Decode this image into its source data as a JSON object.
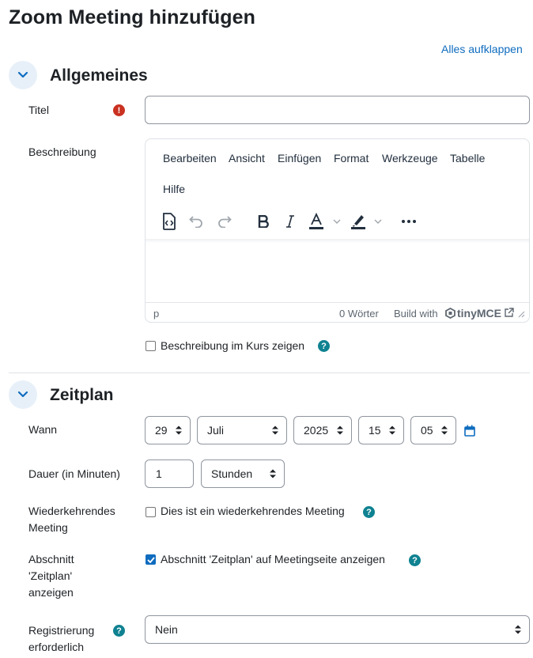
{
  "page": {
    "title": "Zoom Meeting hinzufügen",
    "expand_all": "Alles aufklappen"
  },
  "sections": {
    "general": {
      "title": "Allgemeines"
    },
    "schedule": {
      "title": "Zeitplan"
    }
  },
  "fields": {
    "title": {
      "label": "Titel",
      "value": ""
    },
    "description": {
      "label": "Beschreibung",
      "menu": [
        "Bearbeiten",
        "Ansicht",
        "Einfügen",
        "Format",
        "Werkzeuge",
        "Tabelle",
        "Hilfe"
      ],
      "statusbar": {
        "path": "p",
        "word_count": "0 Wörter",
        "build_with": "Build with",
        "brand": "tinyMCE"
      },
      "show_in_course_label": "Beschreibung im Kurs zeigen",
      "show_in_course_checked": false
    },
    "when": {
      "label": "Wann",
      "day": "29",
      "month": "Juli",
      "year": "2025",
      "hour": "15",
      "minute": "05"
    },
    "duration": {
      "label": "Dauer (in Minuten)",
      "value": "1",
      "unit": "Stunden"
    },
    "recurring": {
      "label": "Wiederkehrendes Meeting",
      "checkbox_label": "Dies ist ein wiederkehrendes Meeting",
      "checked": false
    },
    "show_schedule": {
      "label": "Abschnitt 'Zeitplan' anzeigen",
      "checkbox_label": "Abschnitt 'Zeitplan' auf Meetingseite anzeigen",
      "checked": true
    },
    "registration": {
      "label": "Registrierung erforderlich",
      "value": "Nein"
    }
  },
  "colors": {
    "link": "#0f6cbf",
    "help": "#0f8291",
    "required": "#ca3120",
    "toggle_bg": "#e7f0f9"
  },
  "icons": {
    "required": "exclamation-icon",
    "help": "question-icon",
    "calendar": "calendar-icon",
    "toggle": "chevron-down-icon"
  }
}
